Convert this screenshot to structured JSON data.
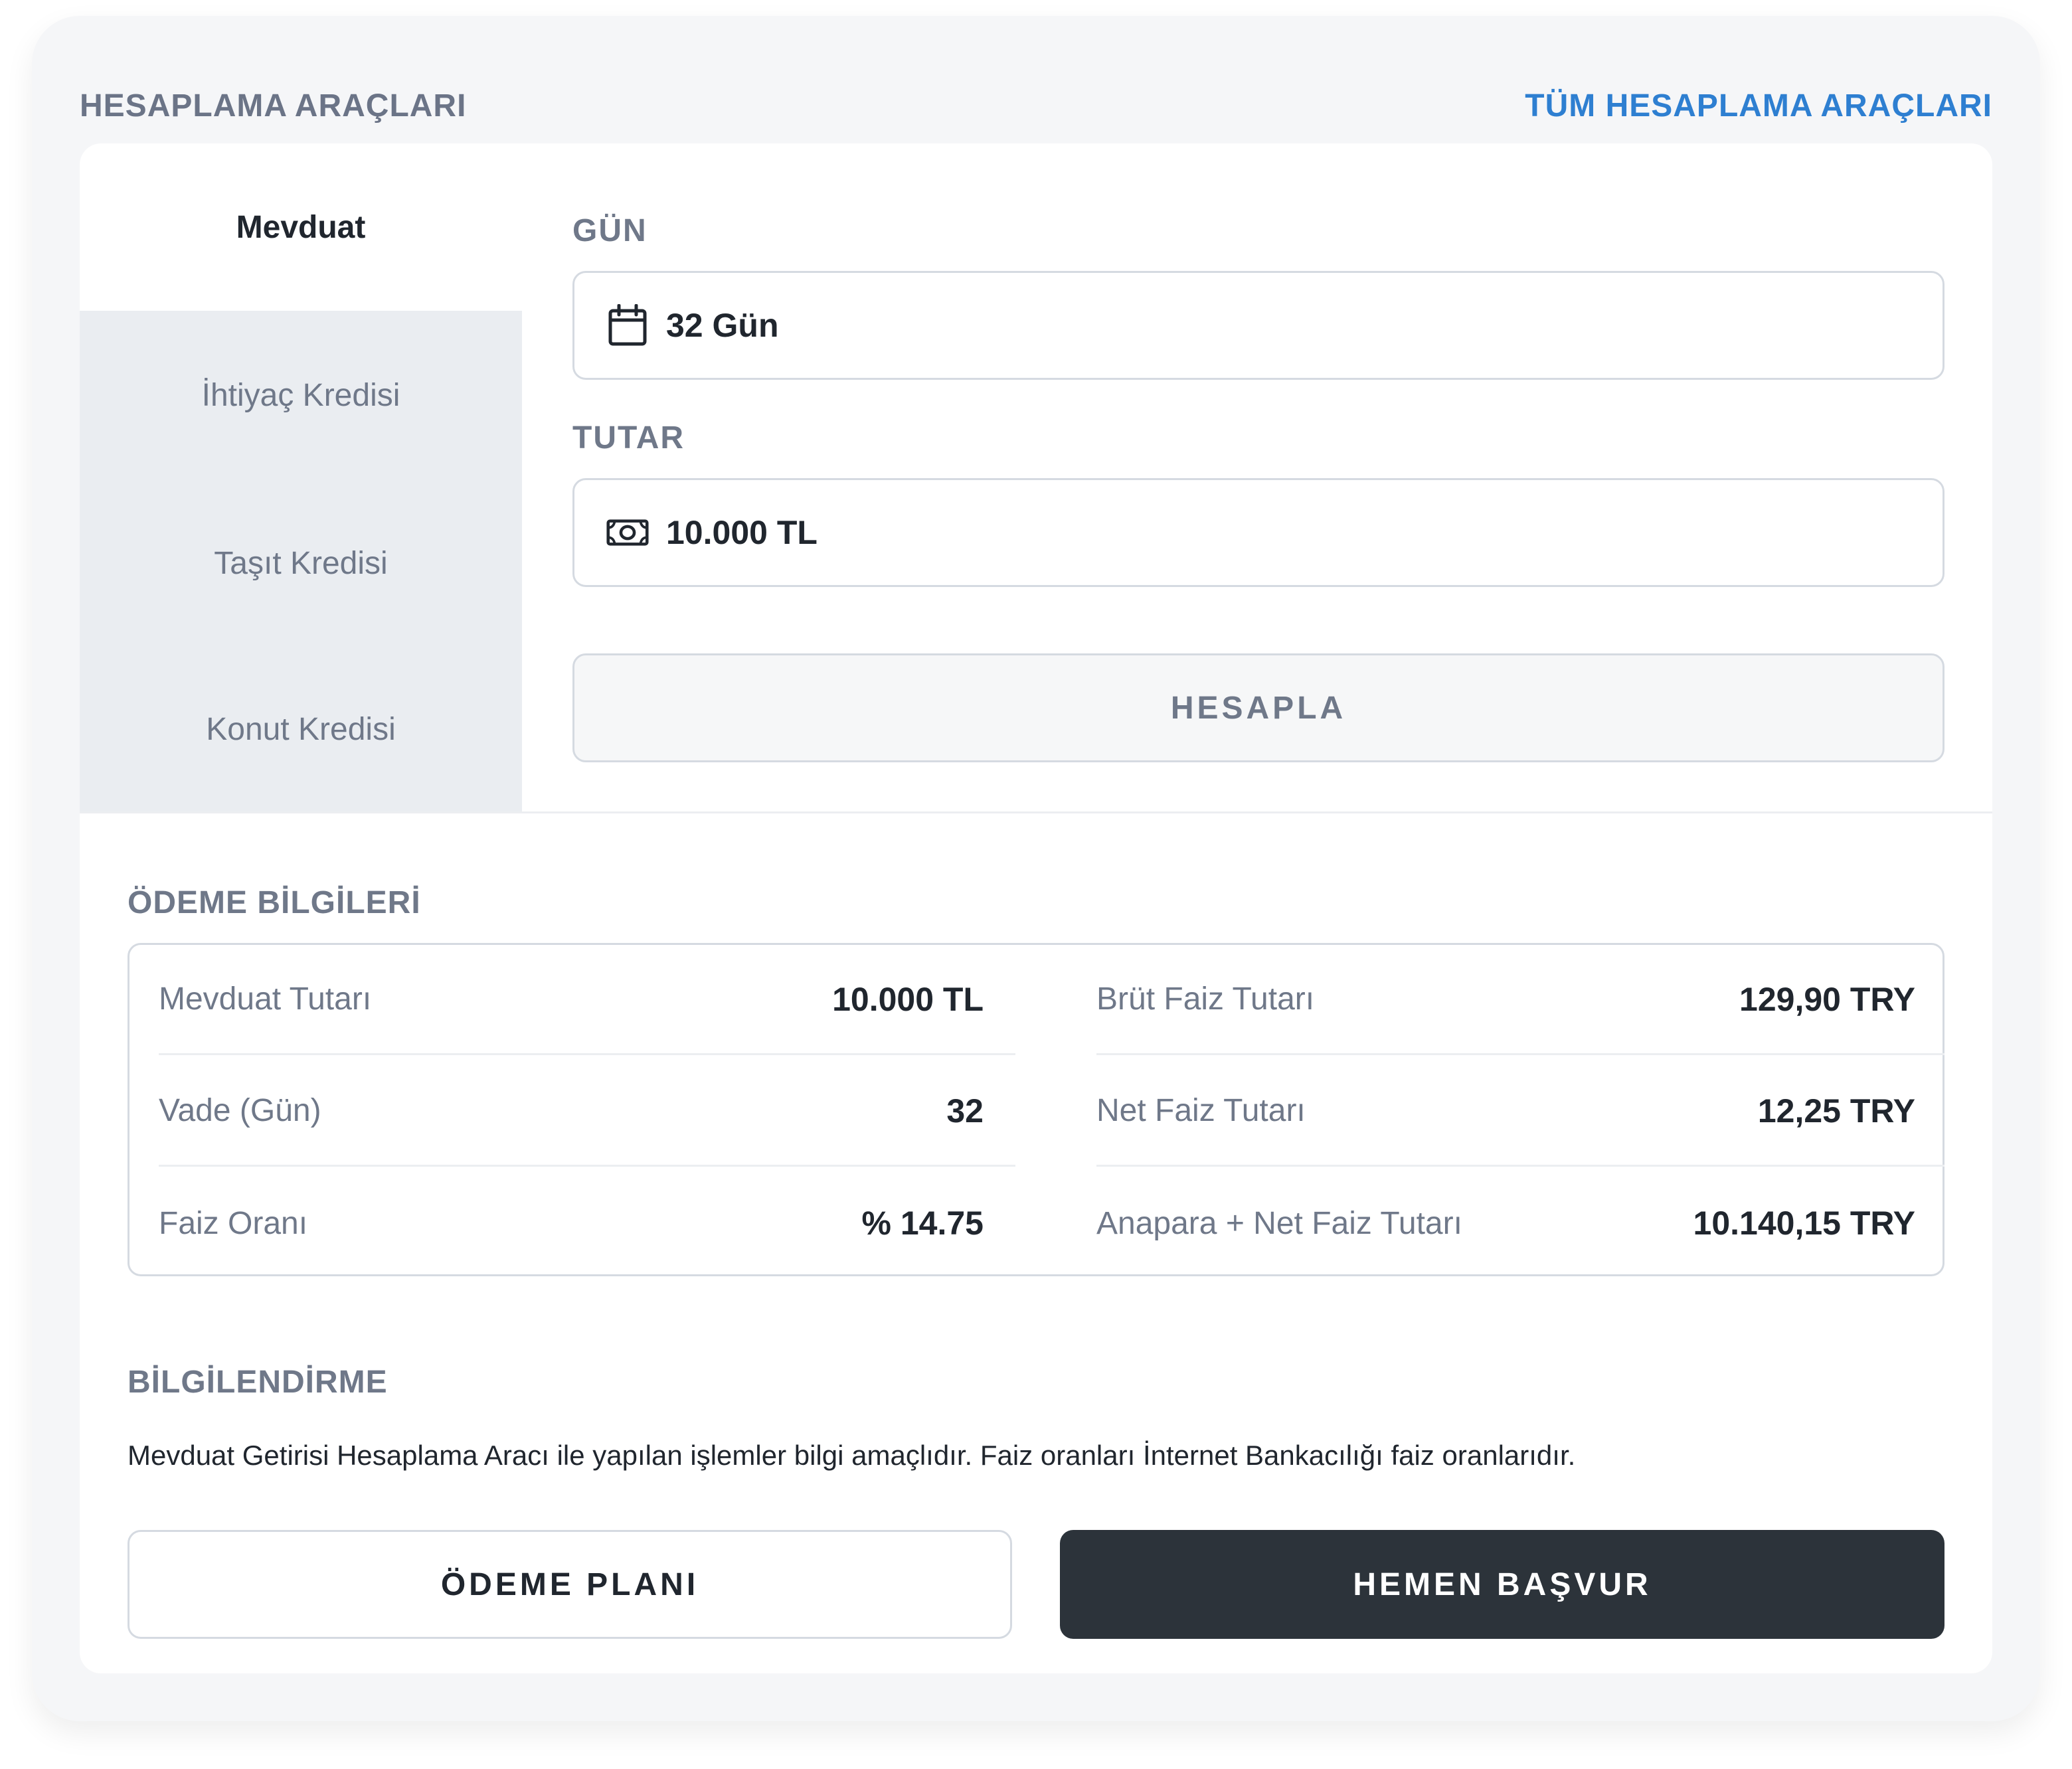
{
  "header": {
    "title": "HESAPLAMA ARAÇLARI",
    "all_tools_link": "TÜM HESAPLAMA ARAÇLARI"
  },
  "tabs": [
    {
      "label": "Mevduat",
      "active": true
    },
    {
      "label": "İhtiyaç Kredisi",
      "active": false
    },
    {
      "label": "Taşıt Kredisi",
      "active": false
    },
    {
      "label": "Konut Kredisi",
      "active": false
    }
  ],
  "form": {
    "day_label": "GÜN",
    "day_value": "32 Gün",
    "amount_label": "TUTAR",
    "amount_value": "10.000 TL",
    "calculate_button": "HESAPLA"
  },
  "payment": {
    "title": "ÖDEME BİLGİLERİ",
    "left": [
      {
        "label": "Mevduat Tutarı",
        "value": "10.000 TL"
      },
      {
        "label": "Vade (Gün)",
        "value": "32"
      },
      {
        "label": "Faiz Oranı",
        "value": "% 14.75"
      }
    ],
    "right": [
      {
        "label": "Brüt Faiz Tutarı",
        "value": "129,90 TRY"
      },
      {
        "label": "Net Faiz Tutarı",
        "value": "12,25 TRY"
      },
      {
        "label": "Anapara + Net Faiz Tutarı",
        "value": "10.140,15 TRY"
      }
    ]
  },
  "info": {
    "title": "BİLGİLENDİRME",
    "text": "Mevduat Getirisi Hesaplama Aracı ile yapılan işlemler bilgi amaçlıdır. Faiz oranları İnternet Bankacılığı faiz oranlarıdır."
  },
  "actions": {
    "plan_button": "ÖDEME PLANI",
    "apply_button": "HEMEN BAŞVUR"
  },
  "colors": {
    "link": "#2e7fd1",
    "primary_button": "#2c333a",
    "muted_text": "#6f7889"
  }
}
